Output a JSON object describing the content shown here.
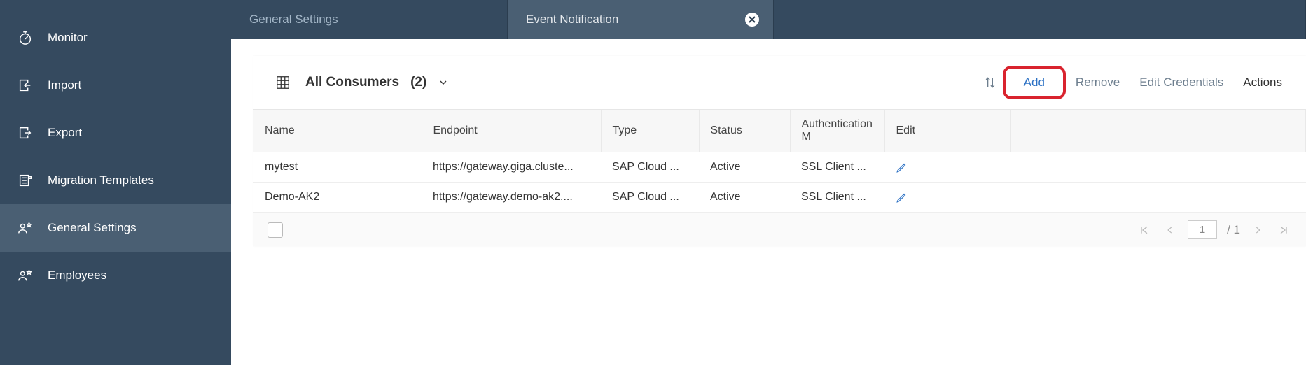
{
  "sidebar": {
    "items": [
      {
        "label": "Monitor"
      },
      {
        "label": "Import"
      },
      {
        "label": "Export"
      },
      {
        "label": "Migration Templates"
      },
      {
        "label": "General Settings"
      },
      {
        "label": "Employees"
      }
    ]
  },
  "tabs": {
    "first": "General Settings",
    "active": "Event Notification"
  },
  "toolbar": {
    "title": "All Consumers",
    "count": "(2)",
    "add": "Add",
    "remove": "Remove",
    "edit_creds": "Edit Credentials",
    "actions": "Actions"
  },
  "table": {
    "headers": {
      "name": "Name",
      "endpoint": "Endpoint",
      "type": "Type",
      "status": "Status",
      "auth": "Authentication M",
      "edit": "Edit"
    },
    "rows": [
      {
        "name": "mytest",
        "endpoint": "https://gateway.giga.cluste...",
        "type": "SAP Cloud ...",
        "status": "Active",
        "auth": "SSL Client ..."
      },
      {
        "name": "Demo-AK2",
        "endpoint": "https://gateway.demo-ak2....",
        "type": "SAP Cloud ...",
        "status": "Active",
        "auth": "SSL Client ..."
      }
    ]
  },
  "pager": {
    "current": "1",
    "total": "/ 1"
  }
}
